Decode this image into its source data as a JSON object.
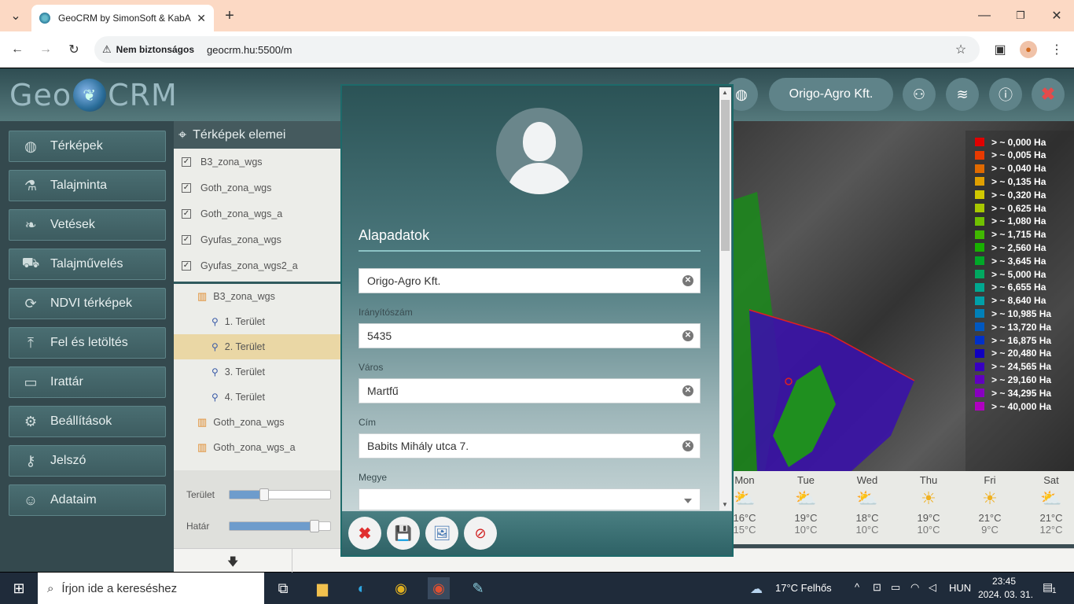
{
  "browser": {
    "tab_title": "GeoCRM by SimonSoft & KabA",
    "security_label": "Nem biztonságos",
    "url": "geocrm.hu:5500/m"
  },
  "app": {
    "logo_left": "Geo",
    "logo_right": "CRM",
    "org_button": "Origo-Agro Kft."
  },
  "sidebar": {
    "items": [
      {
        "label": "Térképek",
        "icon": "globe-icon"
      },
      {
        "label": "Talajminta",
        "icon": "flask-icon"
      },
      {
        "label": "Vetések",
        "icon": "seed-icon"
      },
      {
        "label": "Talajművelés",
        "icon": "tractor-icon"
      },
      {
        "label": "NDVI térképek",
        "icon": "target-icon"
      },
      {
        "label": "Fel és letöltés",
        "icon": "upload-icon"
      },
      {
        "label": "Irattár",
        "icon": "folder-icon"
      },
      {
        "label": "Beállítások",
        "icon": "gear-icon"
      },
      {
        "label": "Jelszó",
        "icon": "key-icon"
      },
      {
        "label": "Adataim",
        "icon": "user-icon"
      }
    ]
  },
  "layers": {
    "title": "Térképek elemei",
    "checked": [
      "B3_zona_wgs",
      "Goth_zona_wgs",
      "Goth_zona_wgs_a",
      "Gyufas_zona_wgs",
      "Gyufas_zona_wgs2_a"
    ],
    "tree": [
      "B3_zona_wgs",
      "1. Terület",
      "2. Terület",
      "3. Terület",
      "4. Terület",
      "Goth_zona_wgs",
      "Goth_zona_wgs_a"
    ],
    "slider1_label": "Terület",
    "slider2_label": "Határ",
    "slider1_value": 0.35,
    "slider2_value": 0.85
  },
  "legend": [
    {
      "label": "> ~ 0,000 Ha",
      "color": "#e00000"
    },
    {
      "label": "> ~ 0,005 Ha",
      "color": "#e83a00"
    },
    {
      "label": "> ~ 0,040 Ha",
      "color": "#e06a00"
    },
    {
      "label": "> ~ 0,135 Ha",
      "color": "#e0a000"
    },
    {
      "label": "> ~ 0,320 Ha",
      "color": "#d0c800"
    },
    {
      "label": "> ~ 0,625 Ha",
      "color": "#a8c800"
    },
    {
      "label": "> ~ 1,080 Ha",
      "color": "#70c000"
    },
    {
      "label": "> ~ 1,715 Ha",
      "color": "#40b800"
    },
    {
      "label": "> ~ 2,560 Ha",
      "color": "#18b000"
    },
    {
      "label": "> ~ 3,645 Ha",
      "color": "#00a828"
    },
    {
      "label": "> ~ 5,000 Ha",
      "color": "#00a860"
    },
    {
      "label": "> ~ 6,655 Ha",
      "color": "#00a890"
    },
    {
      "label": "> ~ 8,640 Ha",
      "color": "#00a0a8"
    },
    {
      "label": "> ~ 10,985 Ha",
      "color": "#0080b8"
    },
    {
      "label": "> ~ 13,720 Ha",
      "color": "#0058c0"
    },
    {
      "label": "> ~ 16,875 Ha",
      "color": "#0030c8"
    },
    {
      "label": "> ~ 20,480 Ha",
      "color": "#1000c0"
    },
    {
      "label": "> ~ 24,565 Ha",
      "color": "#3800c0"
    },
    {
      "label": "> ~ 29,160 Ha",
      "color": "#6000c0"
    },
    {
      "label": "> ~ 34,295 Ha",
      "color": "#8800c0"
    },
    {
      "label": "> ~ 40,000 Ha",
      "color": "#b000c0"
    }
  ],
  "weather": [
    {
      "day": "Mon",
      "icon": "cloud-sun-icon",
      "hi": "16°C",
      "lo": "15°C"
    },
    {
      "day": "Tue",
      "icon": "cloud-sun-icon",
      "hi": "19°C",
      "lo": "10°C"
    },
    {
      "day": "Wed",
      "icon": "cloud-sun-icon",
      "hi": "18°C",
      "lo": "10°C"
    },
    {
      "day": "Thu",
      "icon": "sun-icon",
      "hi": "19°C",
      "lo": "10°C"
    },
    {
      "day": "Fri",
      "icon": "sun-icon",
      "hi": "21°C",
      "lo": "9°C"
    },
    {
      "day": "Sat",
      "icon": "cloud-sun-icon",
      "hi": "21°C",
      "lo": "12°C"
    }
  ],
  "modal": {
    "section_title": "Alapadatok",
    "name_value": "Origo-Agro Kft.",
    "zip_label": "Irányítószám",
    "zip_value": "5435",
    "city_label": "Város",
    "city_value": "Martfű",
    "address_label": "Cím",
    "address_value": "Babits Mihály utca 7.",
    "county_label": "Megye",
    "county_value": ""
  },
  "taskbar": {
    "search_placeholder": "Írjon ide a kereséshez",
    "weather": "17°C  Felhős",
    "lang": "HUN",
    "time": "23:45",
    "date": "2024. 03. 31.",
    "notifications": "1"
  }
}
